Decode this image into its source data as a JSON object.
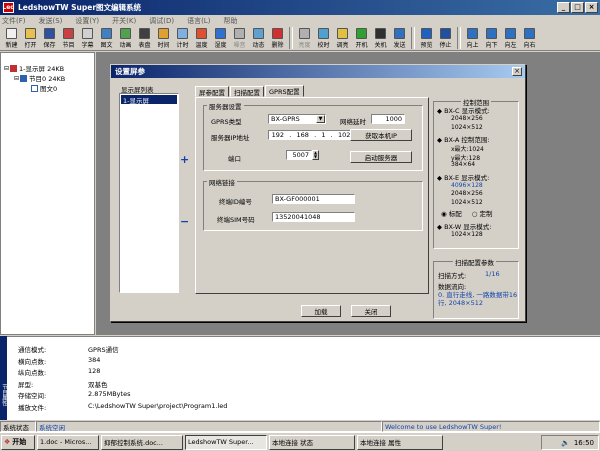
{
  "window": {
    "title": "LedshowTW Super图文编辑系统",
    "app_icon": "Led"
  },
  "menu": [
    "文件(F)",
    "发送(S)",
    "设置(Y)",
    "开关(K)",
    "调试(D)",
    "语言(L)",
    "帮助"
  ],
  "toolbar": [
    {
      "label": "新建",
      "icon": "new-icon",
      "color": "#f0f0f0",
      "enabled": true
    },
    {
      "label": "打开",
      "icon": "open-icon",
      "color": "#e8c050",
      "enabled": true
    },
    {
      "label": "保存",
      "icon": "save-icon",
      "color": "#3050a0",
      "enabled": true
    },
    {
      "label": "节目",
      "icon": "program-icon",
      "color": "#c84040",
      "enabled": true
    },
    {
      "label": "字幕",
      "icon": "subtitle-icon",
      "color": "#d0d0d0",
      "enabled": true
    },
    {
      "label": "图文",
      "icon": "image-text-icon",
      "color": "#4080c0",
      "enabled": true
    },
    {
      "label": "动画",
      "icon": "animation-icon",
      "color": "#50a050",
      "enabled": true
    },
    {
      "label": "表盘",
      "icon": "clock-dial-icon",
      "color": "#404040",
      "enabled": true
    },
    {
      "label": "时间",
      "icon": "time-icon",
      "color": "#e0a030",
      "enabled": true
    },
    {
      "label": "计时",
      "icon": "timer-icon",
      "color": "#80b0e0",
      "enabled": true
    },
    {
      "label": "温度",
      "icon": "temperature-icon",
      "color": "#e05030",
      "enabled": true
    },
    {
      "label": "湿度",
      "icon": "humidity-icon",
      "color": "#3070d0",
      "enabled": true
    },
    {
      "label": "噪音",
      "icon": "noise-icon",
      "color": "#b0b0b0",
      "enabled": false
    },
    {
      "label": "动态",
      "icon": "dynamic-icon",
      "color": "#60a0d0",
      "enabled": true
    },
    {
      "label": "删除",
      "icon": "delete-icon",
      "color": "#d03030",
      "enabled": true
    },
    {
      "label": "|"
    },
    {
      "label": "亮度",
      "icon": "brightness-icon",
      "color": "#b0b0b0",
      "enabled": false
    },
    {
      "label": "校时",
      "icon": "sync-time-icon",
      "color": "#50a0d0",
      "enabled": true
    },
    {
      "label": "调亮",
      "icon": "dim-icon",
      "color": "#e0c040",
      "enabled": true
    },
    {
      "label": "开机",
      "icon": "power-on-icon",
      "color": "#30a030",
      "enabled": true
    },
    {
      "label": "关机",
      "icon": "power-off-icon",
      "color": "#303030",
      "enabled": true
    },
    {
      "label": "发送",
      "icon": "send-icon",
      "color": "#3070c0",
      "enabled": true
    },
    {
      "label": "|"
    },
    {
      "label": "预览",
      "icon": "preview-icon",
      "color": "#2060c0",
      "enabled": true
    },
    {
      "label": "停止",
      "icon": "stop-icon",
      "color": "#2050a0",
      "enabled": true
    },
    {
      "label": "|"
    },
    {
      "label": "向上",
      "icon": "up-icon",
      "color": "#3070c0",
      "enabled": true
    },
    {
      "label": "向下",
      "icon": "down-icon",
      "color": "#3070c0",
      "enabled": true
    },
    {
      "label": "向左",
      "icon": "left-icon",
      "color": "#3070c0",
      "enabled": true
    },
    {
      "label": "向右",
      "icon": "right-icon",
      "color": "#3070c0",
      "enabled": true
    }
  ],
  "tree": {
    "screen": "1-显示屏 24KB",
    "program": "节目0  24KB",
    "item": "图文0"
  },
  "dialog": {
    "title": "设置屏参",
    "list_title": "显示屏列表",
    "list_items": [
      "1-显示屏"
    ],
    "plus": "+",
    "minus": "−",
    "tabs": [
      "屏参配置",
      "扫描配置",
      "GPRS配置"
    ],
    "server_group": "服务器设置",
    "gprs_type_label": "GPRS类型",
    "gprs_type_value": "BX-GPRS",
    "net_delay_label": "网络延时",
    "net_delay_value": "1000",
    "server_ip_label": "服务器IP地址",
    "ip": [
      "192",
      "168",
      "1",
      "102"
    ],
    "get_ip_button": "获取本机IP",
    "port_label": "端口",
    "port_value": "5007",
    "start_server_button": "启动服务器",
    "network_group": "网络链接",
    "terminal_id_label": "终端ID编号",
    "terminal_id_value": "BX-GF000001",
    "sim_label": "终端SIM号码",
    "sim_value": "13520041048",
    "load_button": "加载",
    "close_button": "关闭"
  },
  "control_range": {
    "title": "控制范围",
    "items": [
      {
        "head": "◆ BX-C 显示模式:",
        "lines": [
          "2048×256",
          "1024×512"
        ],
        "color": "#000"
      },
      {
        "head": "◆ BX-A 控制范围:",
        "lines": [
          "x最大:1024",
          "y最大:128",
          "384×64"
        ],
        "color": "#000"
      },
      {
        "head": "◆ BX-E 显示模式:",
        "lines": [
          "4096×128",
          "2048×256",
          "1024×512"
        ],
        "color": "#000",
        "highlight": "4096×128"
      },
      {
        "head": "◆ BX-W 显示模式:",
        "lines": [
          "1024×128"
        ],
        "color": "#000"
      }
    ],
    "radio_standard": "标配",
    "radio_custom": "定制"
  },
  "scan": {
    "title": "扫描配置参数",
    "mode_label": "扫描方式:",
    "mode_value": "1/16",
    "flow_label": "数据流向:",
    "flow_desc": "0. 直行走线, 一路数据带16行, 2048×512"
  },
  "properties": [
    {
      "label": "通信模式:",
      "value": "GPRS通信"
    },
    {
      "label": "横向点数:",
      "value": "384"
    },
    {
      "label": "纵向点数:",
      "value": "128"
    },
    {
      "label": "屏型:",
      "value": "双基色"
    },
    {
      "label": "存储空间:",
      "value": "2.875MBytes"
    },
    {
      "label": "播放文件:",
      "value": "C:\\LedshowTW Super\\project\\Program1.led"
    }
  ],
  "side_label": "节目属性",
  "status": {
    "label": "系统状态",
    "value": "系统空闲",
    "message": "Welcome to use LedshowTW Super!"
  },
  "taskbar": {
    "start": "开始",
    "tasks": [
      "1.doc - Micros...",
      "抑郁控制系统.doc...",
      "LedshowTW Super...",
      "本地连接 状态",
      "本地连接 属性"
    ],
    "clock": "16:50"
  }
}
